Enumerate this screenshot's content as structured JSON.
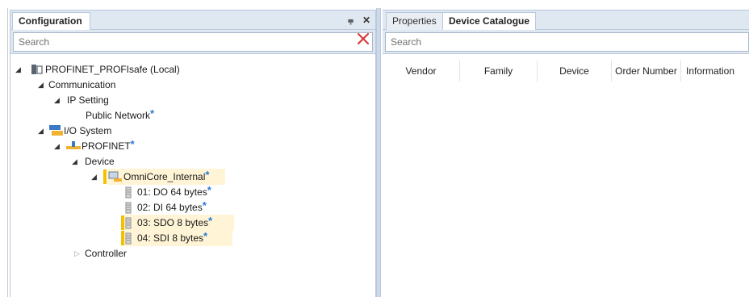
{
  "left_panel": {
    "title": "Configuration",
    "pin_glyph": "⩦",
    "close_glyph": "✕",
    "search_placeholder": "Search",
    "tree": {
      "root": "PROFINET_PROFIsafe (Local)",
      "communication": "Communication",
      "ip_setting": "IP Setting",
      "public_network": "Public Network",
      "io_system": "I/O System",
      "profinet": "PROFINET",
      "device": "Device",
      "omnicore": "OmniCore_Internal",
      "mod1": "01: DO 64 bytes",
      "mod2": "02: DI 64 bytes",
      "mod3": "03: SDO 8 bytes",
      "mod4": "04: SDI 8 bytes",
      "controller": "Controller",
      "modified_mark": "*"
    }
  },
  "right_panel": {
    "tabs": [
      "Properties",
      "Device Catalogue"
    ],
    "search_placeholder": "Search",
    "columns": [
      "Vendor",
      "Family",
      "Device",
      "Order Number",
      "Information"
    ]
  },
  "colors": {
    "header_bg": "#dfe7f1",
    "border": "#b9c9dc",
    "modified_star": "#2a7bd4",
    "highlight": "#fff4d6",
    "safety_marker": "#f2c200",
    "clear_icon": "#d93a3a"
  }
}
